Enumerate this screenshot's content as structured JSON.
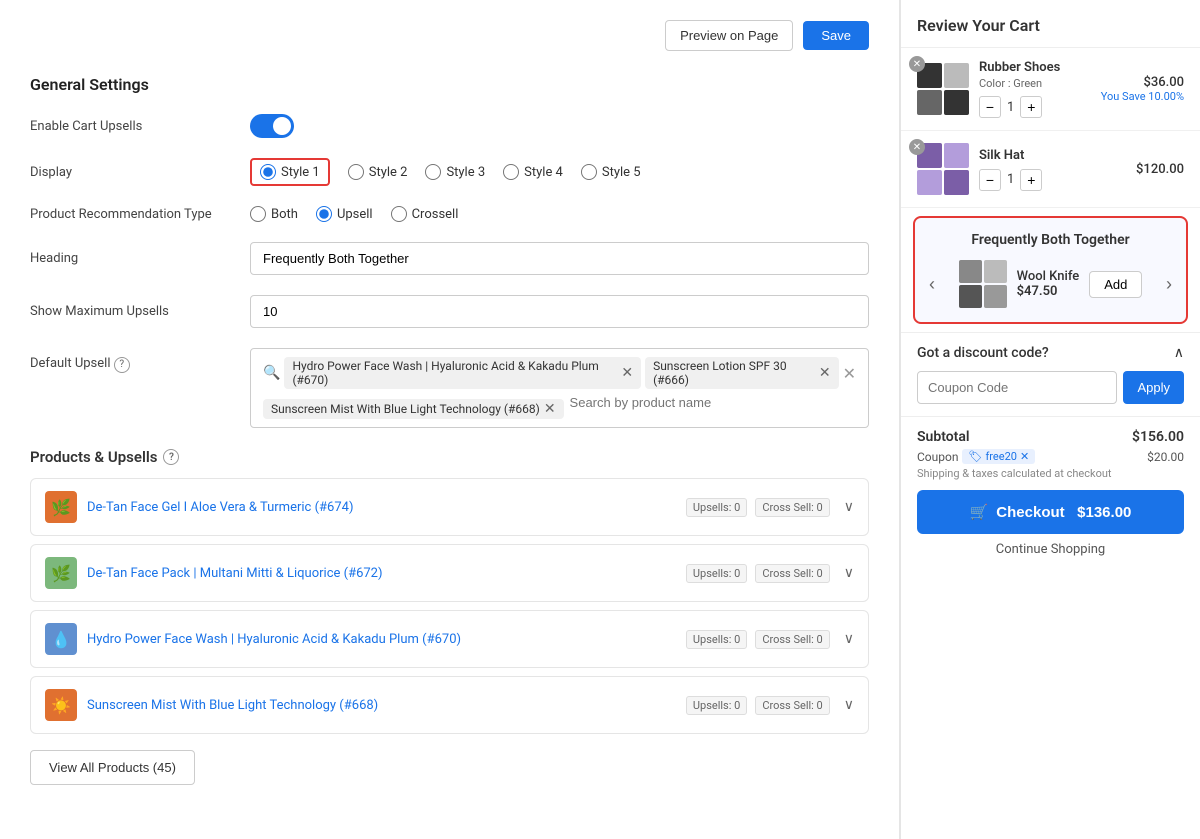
{
  "topbar": {
    "preview_label": "Preview on Page",
    "save_label": "Save"
  },
  "general_settings": {
    "title": "General Settings",
    "enable_cart_upsells_label": "Enable Cart Upsells",
    "display_label": "Display",
    "display_options": [
      "Style 1",
      "Style 2",
      "Style 3",
      "Style 4",
      "Style 5"
    ],
    "selected_display": "Style 1",
    "product_rec_label": "Product Recommendation Type",
    "rec_options": [
      "Both",
      "Upsell",
      "Crossell"
    ],
    "selected_rec": "Upsell",
    "heading_label": "Heading",
    "heading_value": "Frequently Both Together",
    "show_max_label": "Show Maximum Upsells",
    "show_max_value": "10",
    "default_upsell_label": "Default Upsell",
    "default_upsell_tags": [
      "Hydro Power Face Wash | Hyaluronic Acid & Kakadu Plum (#670)",
      "Sunscreen Lotion SPF 30 (#666)",
      "Sunscreen Mist With Blue Light Technology (#668)"
    ],
    "search_placeholder": "Search by product name"
  },
  "products_upsells": {
    "title": "Products & Upsells",
    "products": [
      {
        "id": 1,
        "name": "De-Tan Face Gel I Aloe Vera & Turmeric (#674)",
        "upsells": "Upsells: 0",
        "cross_sell": "Cross Sell: 0",
        "thumb_color": "orange"
      },
      {
        "id": 2,
        "name": "De-Tan Face Pack | Multani Mitti & Liquorice (#672)",
        "upsells": "Upsells: 0",
        "cross_sell": "Cross Sell: 0",
        "thumb_color": "green"
      },
      {
        "id": 3,
        "name": "Hydro Power Face Wash | Hyaluronic Acid & Kakadu Plum (#670)",
        "upsells": "Upsells: 0",
        "cross_sell": "Cross Sell: 0",
        "thumb_color": "blue"
      },
      {
        "id": 4,
        "name": "Sunscreen Mist With Blue Light Technology (#668)",
        "upsells": "Upsells: 0",
        "cross_sell": "Cross Sell: 0",
        "thumb_color": "orange2"
      }
    ],
    "view_all_label": "View All Products (45)"
  },
  "cart": {
    "title": "Review Your Cart",
    "items": [
      {
        "name": "Rubber Shoes",
        "sub": "Color : Green",
        "price": "$36.00",
        "save": "You Save 10.00%",
        "qty": 1
      },
      {
        "name": "Silk Hat",
        "sub": "",
        "price": "$120.00",
        "save": "",
        "qty": 1
      }
    ],
    "fbt": {
      "title": "Frequently Both Together",
      "product_name": "Wool Knife",
      "product_price": "$47.50",
      "add_label": "Add"
    },
    "discount": {
      "header": "Got a discount code?",
      "placeholder": "Coupon Code",
      "apply_label": "Apply"
    },
    "subtotal": {
      "label": "Subtotal",
      "amount": "$156.00",
      "coupon_label": "Coupon",
      "coupon_code": "free20",
      "coupon_discount": "$20.00",
      "shipping_note": "Shipping & taxes calculated at checkout"
    },
    "checkout": {
      "label": "Checkout",
      "total": "$136.00"
    },
    "continue_shopping": "Continue Shopping"
  }
}
